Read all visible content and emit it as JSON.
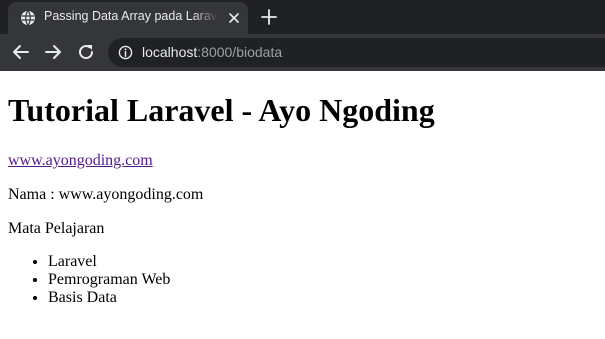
{
  "browser": {
    "tab": {
      "title": "Passing Data Array pada Laravel"
    },
    "address": {
      "host": "localhost",
      "rest": ":8000/biodata"
    }
  },
  "page": {
    "heading": "Tutorial Laravel - Ayo Ngoding",
    "link": "www.ayongoding.com",
    "nama": "Nama : www.ayongoding.com",
    "mapel_label": "Mata Pelajaran",
    "mapel": [
      "Laravel",
      "Pemrograman Web",
      "Basis Data"
    ]
  },
  "colors": {
    "chrome_dark": "#202124",
    "chrome_tab": "#35363a",
    "visited_link": "#551a8b"
  }
}
